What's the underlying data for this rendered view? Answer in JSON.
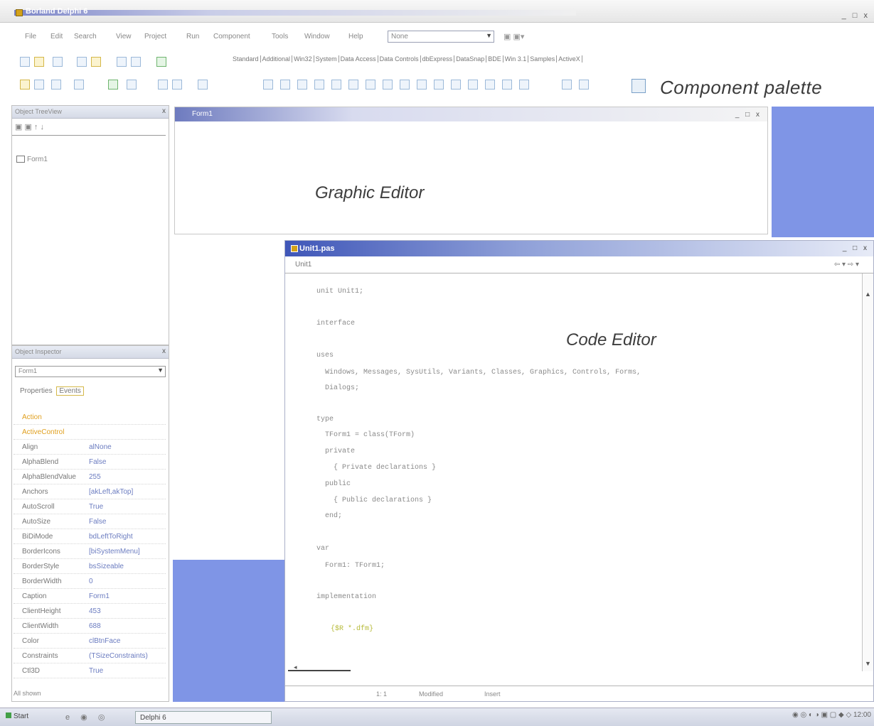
{
  "ide": {
    "title": "Borland Delphi 6",
    "window_buttons": "_ □ x"
  },
  "menu": {
    "items": [
      "File",
      "Edit",
      "Search",
      "View",
      "Project",
      "Run",
      "Component",
      "Tools",
      "Window",
      "Help"
    ],
    "desktop_value": "None",
    "desktop_tools": "▣ ▣▾"
  },
  "palette": {
    "tabs": [
      "Standard",
      "Additional",
      "Win32",
      "System",
      "Data Access",
      "Data Controls",
      "dbExpress",
      "DataSnap",
      "BDE",
      "Win 3.1",
      "Samples",
      "ActiveX"
    ],
    "title": "Component palette"
  },
  "object_tree": {
    "header": "Object TreeView",
    "toolbar": "▣ ▣  ↑ ↓",
    "node": "Form1"
  },
  "inspector": {
    "header": "Object Inspector",
    "selector": "Form1",
    "tabs": [
      "Properties",
      "Events"
    ],
    "footer": "All shown",
    "properties": [
      {
        "name": "Action",
        "value": ""
      },
      {
        "name": "ActiveControl",
        "value": ""
      },
      {
        "name": "Align",
        "value": "alNone"
      },
      {
        "name": "AlphaBlend",
        "value": "False"
      },
      {
        "name": "AlphaBlendValue",
        "value": "255"
      },
      {
        "name": "Anchors",
        "value": "[akLeft,akTop]"
      },
      {
        "name": "AutoScroll",
        "value": "True"
      },
      {
        "name": "AutoSize",
        "value": "False"
      },
      {
        "name": "BiDiMode",
        "value": "bdLeftToRight"
      },
      {
        "name": "BorderIcons",
        "value": "[biSystemMenu]"
      },
      {
        "name": "BorderStyle",
        "value": "bsSizeable"
      },
      {
        "name": "BorderWidth",
        "value": "0"
      },
      {
        "name": "Caption",
        "value": "Form1"
      },
      {
        "name": "ClientHeight",
        "value": "453"
      },
      {
        "name": "ClientWidth",
        "value": "688"
      },
      {
        "name": "Color",
        "value": "clBtnFace"
      },
      {
        "name": "Constraints",
        "value": "(TSizeConstraints)"
      },
      {
        "name": "Ctl3D",
        "value": "True"
      }
    ]
  },
  "form_designer": {
    "title": "Form1",
    "label": "Graphic Editor",
    "window_buttons": "_ □ x"
  },
  "code_editor": {
    "title": "Unit1.pas",
    "unit_tab": "Unit1",
    "right_controls": "⇦ ▾ ⇨ ▾",
    "label": "Code Editor",
    "window_buttons": "_ □ x",
    "lines": [
      "unit Unit1;",
      "",
      "interface",
      "",
      "uses",
      "  Windows, Messages, SysUtils, Variants, Classes, Graphics, Controls, Forms,",
      "  Dialogs;",
      "",
      "type",
      "  TForm1 = class(TForm)",
      "  private",
      "    { Private declarations }",
      "  public",
      "    { Public declarations }",
      "  end;",
      "",
      "var",
      "  Form1: TForm1;",
      "",
      "implementation",
      "",
      "{$R *.dfm}"
    ],
    "status": {
      "position": "1: 1",
      "modified": "Modified",
      "mode": "Insert"
    },
    "hscroll_left": "◂"
  },
  "taskbar": {
    "start": "Start",
    "quick": "e ◉ ◎",
    "task": "Delphi 6",
    "tray": "◉ ◎ ◐ ◑ ▣ ▢ ◆ ◇ 12:00"
  }
}
